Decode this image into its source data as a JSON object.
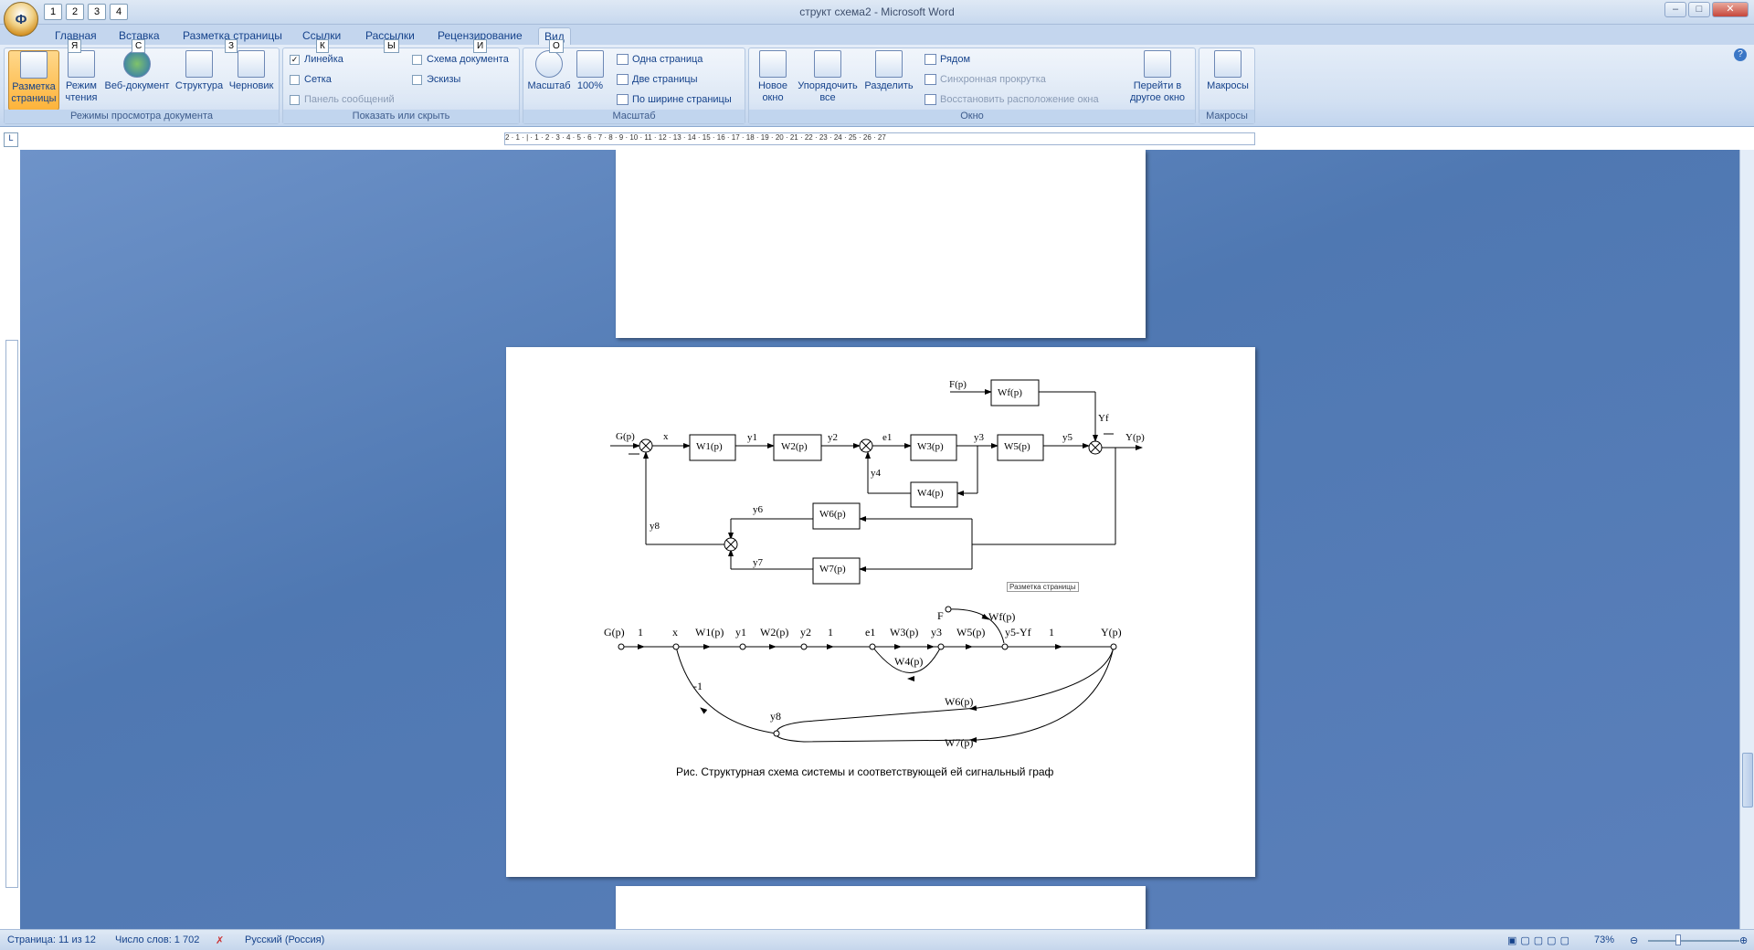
{
  "window": {
    "title": "структ схема2 - Microsoft Word",
    "office_button": "Ф",
    "qat_keytips": [
      "1",
      "2",
      "3",
      "4"
    ]
  },
  "tabs": [
    {
      "label": "Главная",
      "keytip": "Я"
    },
    {
      "label": "Вставка",
      "keytip": "С"
    },
    {
      "label": "Разметка страницы",
      "keytip": "З"
    },
    {
      "label": "Ссылки",
      "keytip": "К"
    },
    {
      "label": "Рассылки",
      "keytip": "Ы"
    },
    {
      "label": "Рецензирование",
      "keytip": "И"
    },
    {
      "label": "Вид",
      "keytip": "О"
    }
  ],
  "ribbon": {
    "views_group": {
      "label": "Режимы просмотра документа",
      "buttons": [
        "Разметка страницы",
        "Режим чтения",
        "Веб-документ",
        "Структура",
        "Черновик"
      ]
    },
    "show_group": {
      "label": "Показать или скрыть",
      "ruler": "Линейка",
      "grid": "Сетка",
      "message_bar": "Панель сообщений",
      "doc_map": "Схема документа",
      "thumbnails": "Эскизы"
    },
    "zoom_group": {
      "label": "Масштаб",
      "zoom": "Масштаб",
      "hundred": "100%",
      "one_page": "Одна страница",
      "two_pages": "Две страницы",
      "page_width": "По ширине страницы"
    },
    "window_group": {
      "label": "Окно",
      "new_window": "Новое окно",
      "arrange_all": "Упорядочить все",
      "split": "Разделить",
      "side_by_side": "Рядом",
      "sync_scroll": "Синхронная прокрутка",
      "reset_pos": "Восстановить расположение окна",
      "switch_window": "Перейти в другое окно"
    },
    "macros_group": {
      "label": "Макросы",
      "macros": "Макросы"
    }
  },
  "document": {
    "tooltip": "Разметка страницы",
    "caption": "Рис. Структурная схема системы и соответствующей ей сигнальный граф",
    "block_diagram": {
      "labels": {
        "F": "F(p)",
        "Wf": "Wf(p)",
        "Yf": "Yf",
        "G": "G(p)",
        "x": "x",
        "W1": "W1(p)",
        "y1": "y1",
        "W2": "W2(p)",
        "y2": "y2",
        "e1": "e1",
        "W3": "W3(p)",
        "y3": "y3",
        "W5": "W5(p)",
        "y5": "y5",
        "Y": "Y(p)",
        "y4": "y4",
        "W4": "W4(p)",
        "y6": "y6",
        "W6": "W6(p)",
        "y8": "y8",
        "y7": "y7",
        "W7": "W7(p)"
      }
    },
    "signal_graph": {
      "labels": {
        "G": "G(p)",
        "one1": "1",
        "x": "x",
        "W1": "W1(p)",
        "y1": "y1",
        "W2": "W2(p)",
        "y2": "y2",
        "one2": "1",
        "e1": "e1",
        "W3": "W3(p)",
        "y3": "y3",
        "W5": "W5(p)",
        "y5Yf": "y5-Yf",
        "one3": "1",
        "Y": "Y(p)",
        "F": "F",
        "Wf": "Wf(p)",
        "W4": "W4(p)",
        "minus1": "-1",
        "y8": "y8",
        "W6": "W6(p)",
        "W7": "W7(p)"
      }
    }
  },
  "status": {
    "page": "Страница: 11 из 12",
    "words": "Число слов: 1 702",
    "language": "Русский (Россия)",
    "zoom": "73%"
  }
}
